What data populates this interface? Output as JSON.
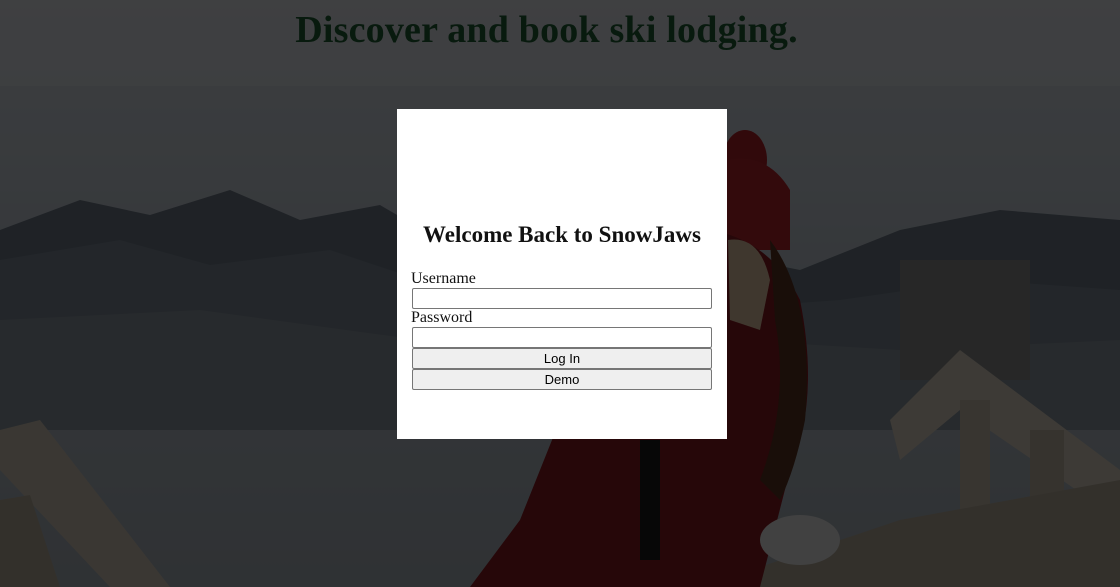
{
  "hero": {
    "headline": "Discover and book ski lodging."
  },
  "login_modal": {
    "title": "Welcome Back to SnowJaws",
    "username_label": "Username",
    "username_value": "",
    "password_label": "Password",
    "password_value": "",
    "login_button": "Log In",
    "demo_button": "Demo"
  },
  "colors": {
    "headline": "#081a0e",
    "modal_background": "#ffffff",
    "overlay": "rgba(0,0,0,0.72)"
  }
}
